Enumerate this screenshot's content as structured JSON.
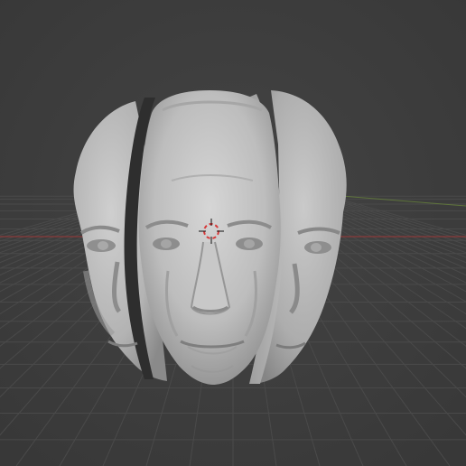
{
  "app": {
    "name": "3D viewport",
    "view": "perspective"
  },
  "viewport": {
    "background_color": "#3d3d3d",
    "grid_color": "#4a4a4a",
    "x_axis_color": "#8a3a3a",
    "y_axis_color": "#6b8a3a",
    "grid_visible": true
  },
  "scene": {
    "objects": [
      {
        "name": "face-left-copy",
        "shading": "solid-matcap",
        "color": "#b9b9b9"
      },
      {
        "name": "face-center",
        "shading": "solid-matcap",
        "color": "#c4c4c4"
      },
      {
        "name": "face-right-copy",
        "shading": "solid-matcap",
        "color": "#b5b5b5"
      }
    ],
    "cursor_icon": "3d-cursor-icon",
    "cursor_colors": [
      "#d63a3a",
      "#ffffff"
    ]
  }
}
